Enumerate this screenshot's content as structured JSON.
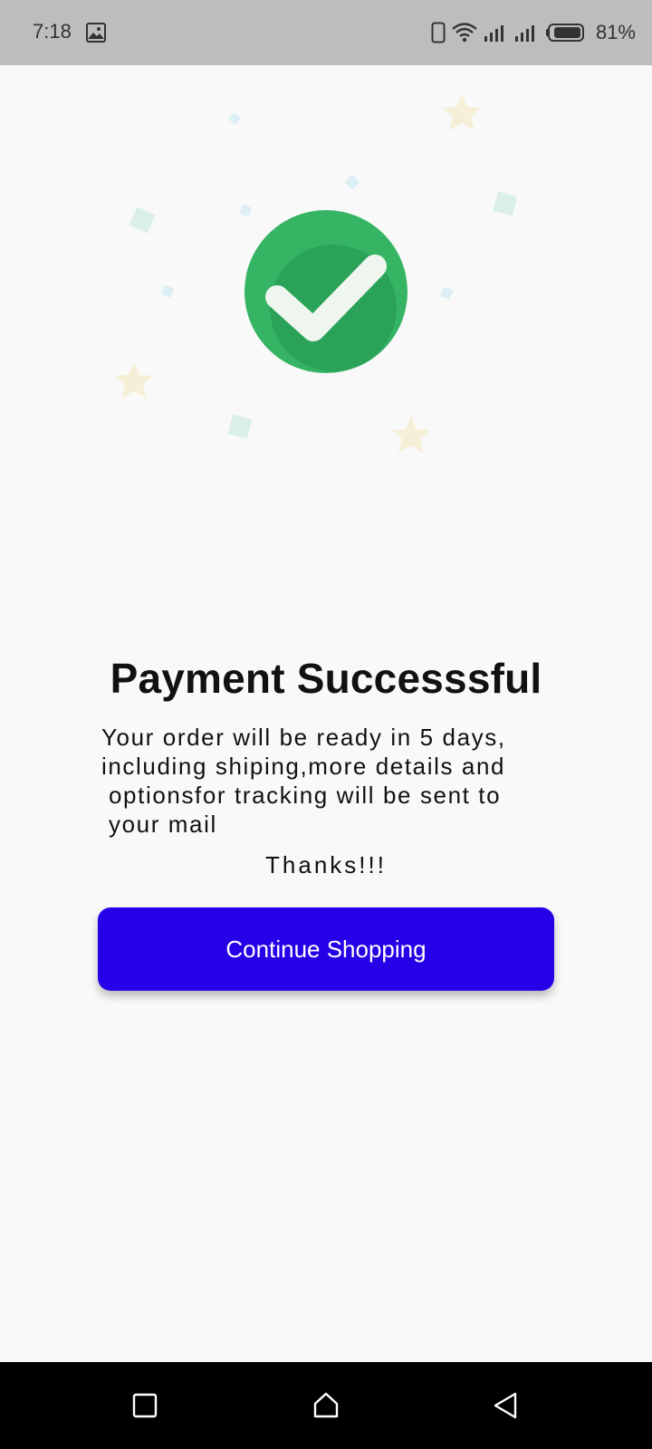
{
  "status_bar": {
    "time": "7:18",
    "battery_percent": "81%",
    "icons": [
      "gallery-icon",
      "phone-icon",
      "wifi-icon",
      "signal-icon",
      "signal-icon",
      "battery-icon"
    ]
  },
  "illustration": {
    "icon": "check-circle-icon",
    "colors": {
      "circle": "#35b564",
      "circle_shadow": "#2aa257",
      "check": "#eef6ef",
      "confetti_green": "#d9efe8",
      "confetti_blue": "#dceff5",
      "confetti_star": "#f6efd8"
    }
  },
  "main": {
    "title": "Payment Successsful",
    "message_lines": [
      "Your order will be ready in 5 days,",
      "including shiping,more details and",
      "optionsfor tracking will be sent to",
      "your mail"
    ],
    "thanks": "Thanks!!!",
    "continue_button_label": "Continue Shopping",
    "accent_color": "#2600e6"
  },
  "nav_bar": {
    "buttons": [
      "recent-apps-icon",
      "home-icon",
      "back-icon"
    ]
  }
}
